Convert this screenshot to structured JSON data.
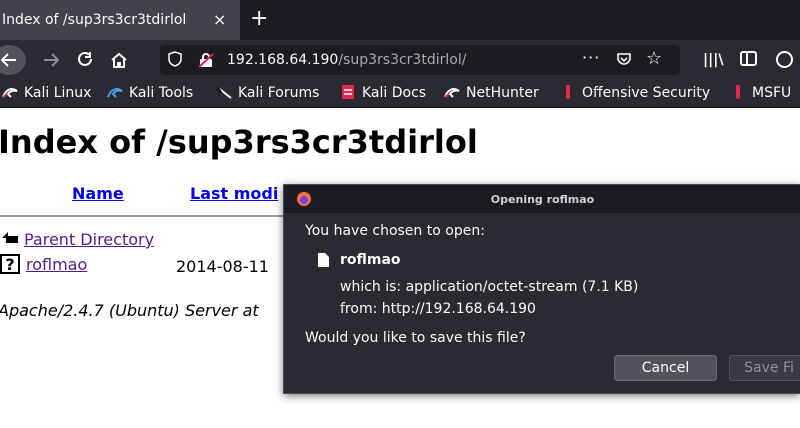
{
  "tab": {
    "title": "Index of /sup3rs3cr3tdirlol",
    "close": "×",
    "new_tab": "+"
  },
  "nav": {
    "url_host": "192.168.64.190",
    "url_path": "/sup3rs3cr3tdirlol/",
    "more": "···"
  },
  "bookmarks": [
    {
      "label": "Kali Linux",
      "icon": "kali-dragon-icon"
    },
    {
      "label": "Kali Tools",
      "icon": "kali-dragon-icon"
    },
    {
      "label": "Kali Forums",
      "icon": "kali-forums-icon"
    },
    {
      "label": "Kali Docs",
      "icon": "kali-docs-icon"
    },
    {
      "label": "NetHunter",
      "icon": "nethunter-icon"
    },
    {
      "label": "Offensive Security",
      "icon": "offsec-icon"
    },
    {
      "label": "MSFU",
      "icon": "offsec-icon"
    }
  ],
  "page": {
    "heading": "Index of /sup3rs3cr3tdirlol",
    "columns": {
      "name": "Name",
      "last_modified": "Last modi"
    },
    "rows": [
      {
        "name": "Parent Directory",
        "date": ""
      },
      {
        "name": "roflmao",
        "date": "2014-08-11"
      }
    ],
    "footer": "Apache/2.4.7 (Ubuntu) Server at"
  },
  "dialog": {
    "title": "Opening roflmao",
    "chosen": "You have chosen to open:",
    "filename": "roflmao",
    "which_is": "which is: application/octet-stream (7.1 KB)",
    "from": "from: http://192.168.64.190",
    "question": "Would you like to save this file?",
    "cancel": "Cancel",
    "save": "Save Fi"
  }
}
